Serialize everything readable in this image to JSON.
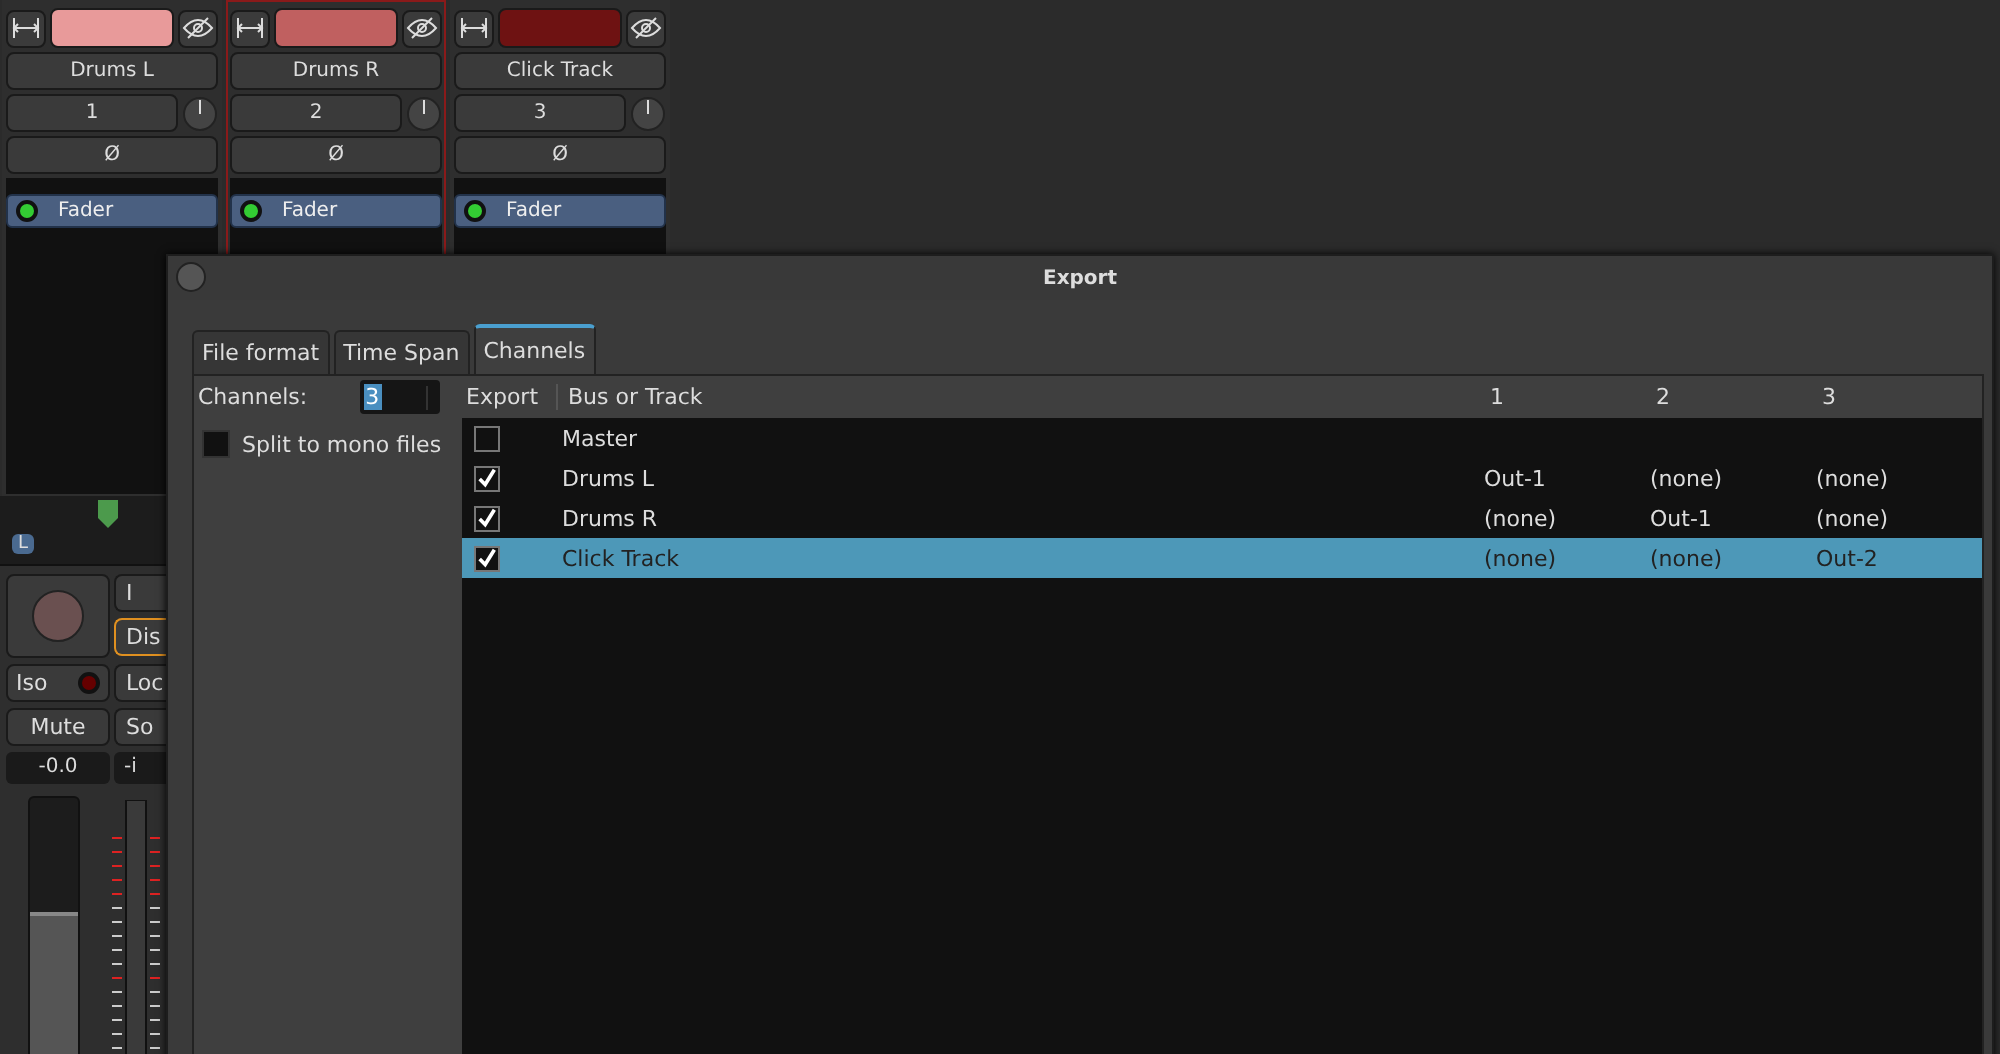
{
  "strips": [
    {
      "name": "Drums L",
      "number": "1",
      "phase": "Ø",
      "processor": "Fader",
      "color": "#e89a9a",
      "selected": false
    },
    {
      "name": "Drums R",
      "number": "2",
      "phase": "Ø",
      "processor": "Fader",
      "color": "#c06060",
      "selected": true
    },
    {
      "name": "Click Track",
      "number": "3",
      "phase": "Ø",
      "processor": "Fader",
      "color": "#6e1212",
      "selected": false
    }
  ],
  "lower_strip": {
    "panner_label": "L",
    "in_button": "I",
    "disk_button": "Dis",
    "iso_button": "Iso",
    "lock_button": "Loc",
    "mute_button": "Mute",
    "solo_button": "So",
    "gain": "-0.0",
    "peak": "-i",
    "fader": {
      "level": 0.58
    }
  },
  "dialog": {
    "title": "Export",
    "tabs": [
      {
        "label": "File format",
        "selected": false
      },
      {
        "label": "Time Span",
        "selected": false
      },
      {
        "label": "Channels",
        "selected": true
      }
    ],
    "channels_label": "Channels:",
    "channels_value": "3",
    "split_mono": {
      "label": "Split to mono files",
      "checked": false
    },
    "table": {
      "export_header": "Export",
      "columns": [
        "Bus or Track",
        "1",
        "2",
        "3"
      ],
      "rows": [
        {
          "checked": false,
          "selected": false,
          "cells": [
            "Master"
          ]
        },
        {
          "checked": true,
          "selected": false,
          "cells": [
            "Drums L",
            "Out-1",
            "(none)",
            "(none)"
          ]
        },
        {
          "checked": true,
          "selected": false,
          "cells": [
            "Drums R",
            "(none)",
            "Out-1",
            "(none)"
          ]
        },
        {
          "checked": true,
          "selected": true,
          "cells": [
            "Click Track",
            "(none)",
            "(none)",
            "Out-2"
          ]
        }
      ]
    }
  }
}
